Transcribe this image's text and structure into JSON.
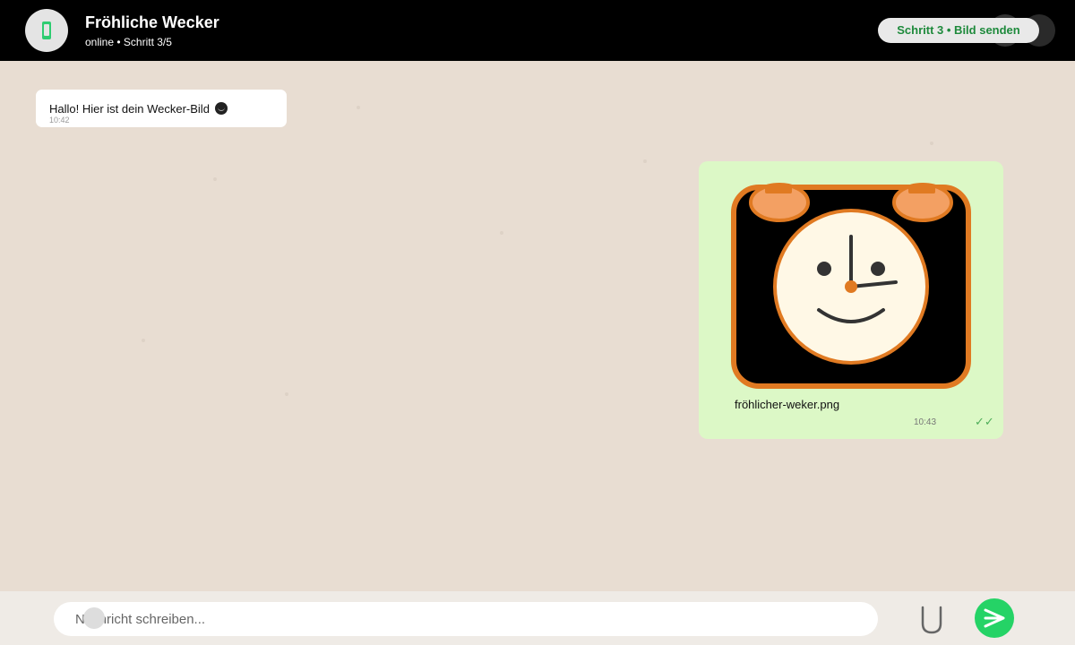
{
  "header": {
    "title": "Fröhliche Wecker",
    "subtitle": "online • Schritt 3/5",
    "step_badge": "Schritt 3 • Bild senden",
    "avatar_icon": "phone-icon"
  },
  "messages": [
    {
      "direction": "incoming",
      "text": "Hallo! Hier ist dein Wecker-Bild",
      "time": "10:42",
      "emoji": "smile-emoji"
    },
    {
      "direction": "outgoing",
      "type": "image",
      "filename": "fröhlicher-weker.png",
      "time": "10:43",
      "status": "✓✓"
    }
  ],
  "composer": {
    "placeholder": "Nachricht schreiben...",
    "attach_icon": "paperclip-icon",
    "send_icon": "send-icon"
  },
  "colors": {
    "header_bg": "#000000",
    "chat_bg": "#e8ddd2",
    "outgoing_bubble": "#dcf8c6",
    "accent": "#25d366",
    "badge_text": "#1e8a3c",
    "clock_orange": "#e07a22"
  }
}
